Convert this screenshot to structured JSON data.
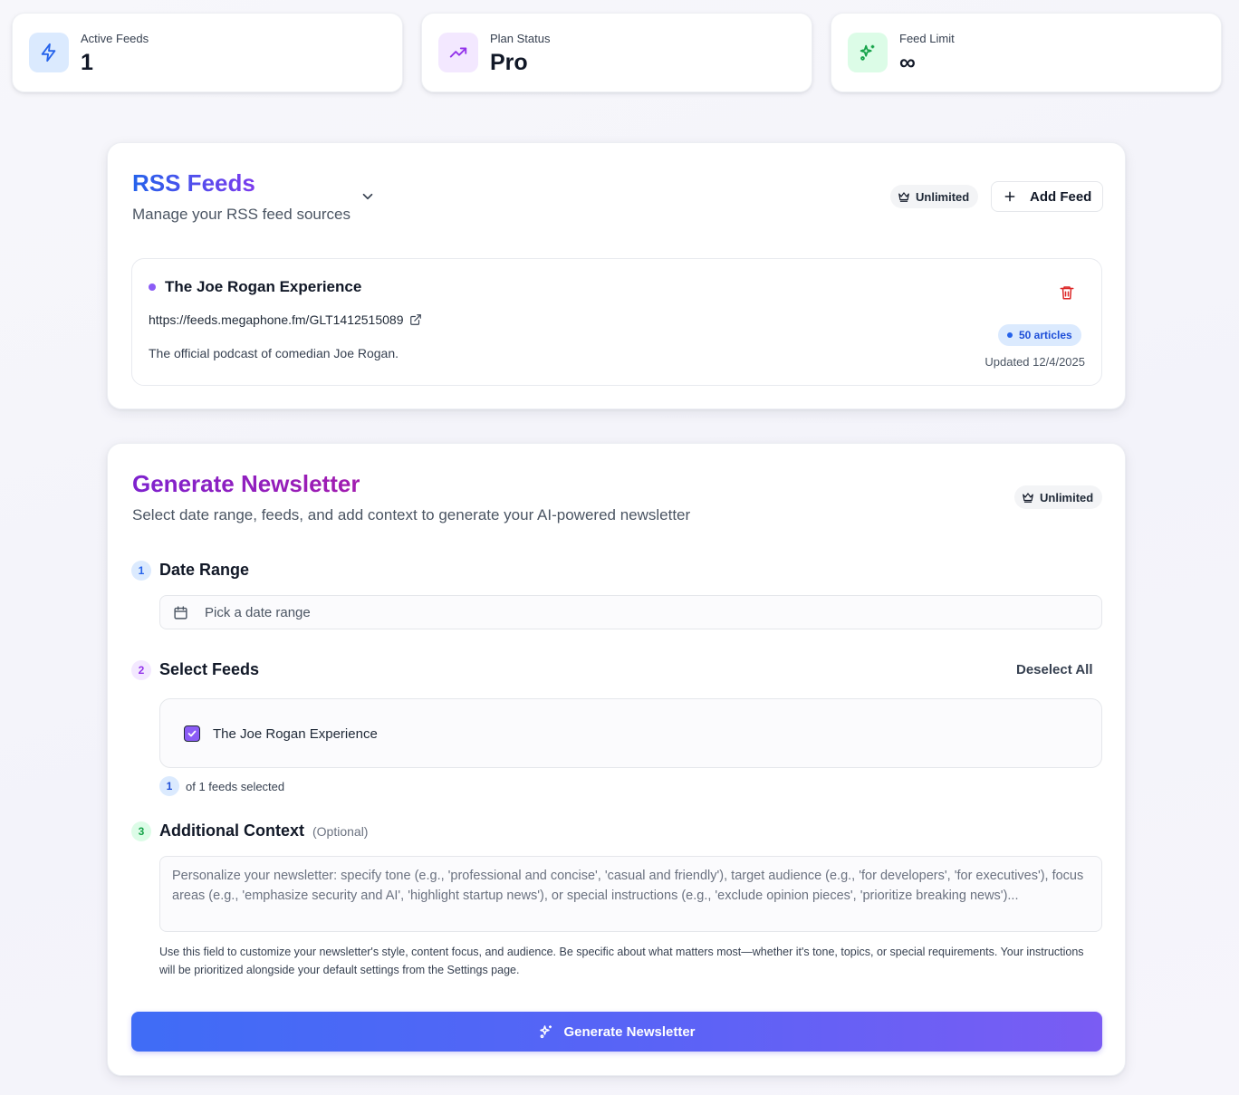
{
  "stats": [
    {
      "label": "Active Feeds",
      "value": "1",
      "icon": "lightning-icon",
      "bg": "#dbeafe",
      "color": "#2563eb"
    },
    {
      "label": "Plan Status",
      "value": "Pro",
      "icon": "trending-up-icon",
      "bg": "#f3e8ff",
      "color": "#9333ea"
    },
    {
      "label": "Feed Limit",
      "value": "∞",
      "icon": "sparkles-icon",
      "bg": "#dcfce7",
      "color": "#16a34a"
    }
  ],
  "rss": {
    "title": "RSS Feeds",
    "subtitle": "Manage your RSS feed sources",
    "badge": "Unlimited",
    "add_button": "Add Feed",
    "feed": {
      "name": "The Joe Rogan Experience",
      "url": "https://feeds.megaphone.fm/GLT1412515089",
      "description": "The official podcast of comedian Joe Rogan.",
      "articles": "50 articles",
      "updated": "Updated 12/4/2025"
    }
  },
  "newsletter": {
    "title": "Generate Newsletter",
    "subtitle": "Select date range, feeds, and add context to generate your AI-powered newsletter",
    "badge": "Unlimited",
    "step1": {
      "num": "1",
      "title": "Date Range",
      "placeholder": "Pick a date range"
    },
    "step2": {
      "num": "2",
      "title": "Select Feeds",
      "deselect": "Deselect All",
      "feed_option": "The Joe Rogan Experience",
      "selected_count": "1",
      "selected_text": "of 1 feeds selected"
    },
    "step3": {
      "num": "3",
      "title": "Additional Context",
      "optional": "(Optional)",
      "placeholder": "Personalize your newsletter: specify tone (e.g., 'professional and concise', 'casual and friendly'), target audience (e.g., 'for developers', 'for executives'), focus areas (e.g., 'emphasize security and AI', 'highlight startup news'), or special instructions (e.g., 'exclude opinion pieces', 'prioritize breaking news')...",
      "help": "Use this field to customize your newsletter's style, content focus, and audience. Be specific about what matters most—whether it's tone, topics, or special requirements. Your instructions will be prioritized alongside your default settings from the Settings page."
    },
    "generate_button": "Generate Newsletter"
  },
  "colors": {
    "blue": "#2563eb",
    "purple": "#9333ea",
    "red": "#dc2626"
  }
}
